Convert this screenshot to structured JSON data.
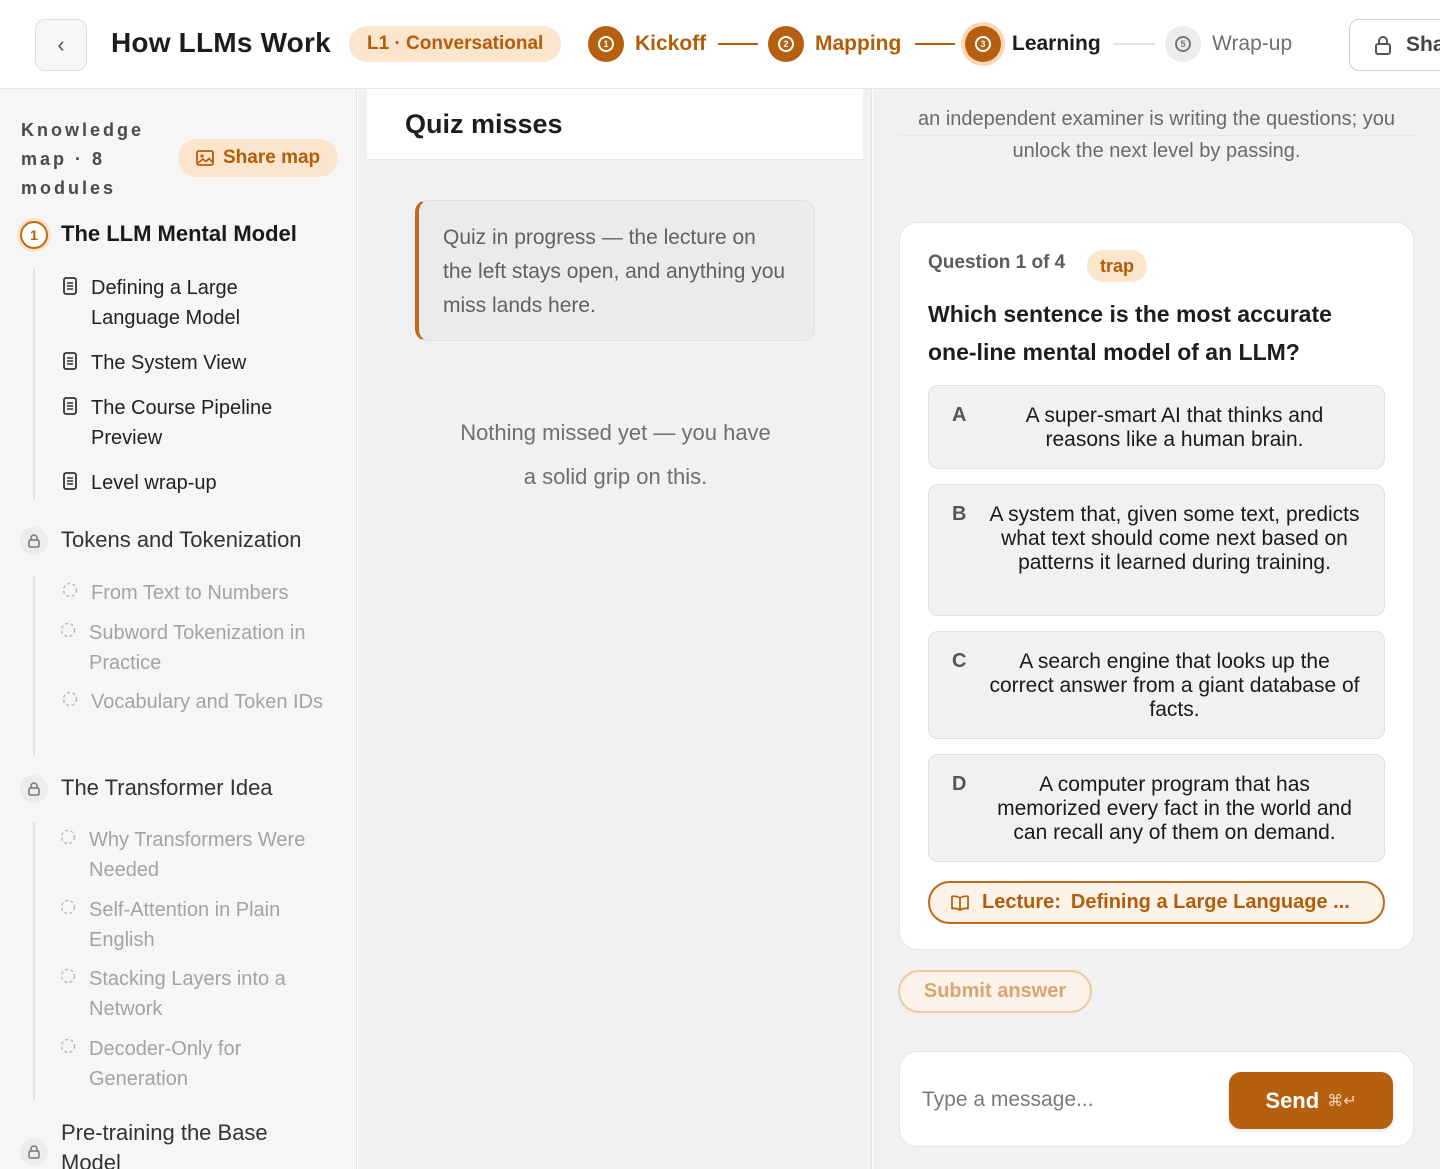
{
  "header": {
    "back_icon": "chevron-left-icon",
    "back_glyph": "‹",
    "title": "How LLMs Work",
    "level_badge": "L1 · Conversational",
    "steps": [
      {
        "num": "1",
        "label": "Kickoff",
        "state": "done"
      },
      {
        "num": "2",
        "label": "Mapping",
        "state": "done"
      },
      {
        "num": "3",
        "label": "Learning",
        "state": "current"
      },
      {
        "num": "5",
        "label": "Wrap-up",
        "state": "pending"
      }
    ],
    "share_label": "Sha"
  },
  "sidebar": {
    "heading": "Knowledge map · 8 modules",
    "share_map_label": "Share map",
    "modules": [
      {
        "num": "1",
        "title": "The LLM Mental Model",
        "state": "active",
        "lessons": [
          "Defining a Large Language Model",
          "The System View",
          "The Course Pipeline Preview",
          "Level wrap-up"
        ]
      },
      {
        "title": "Tokens and Tokenization",
        "state": "locked",
        "lessons": [
          "From Text to Numbers",
          "Subword Tokenization in Practice",
          "Vocabulary and Token IDs"
        ]
      },
      {
        "title": "The Transformer Idea",
        "state": "locked",
        "lessons": [
          "Why Transformers Were Needed",
          "Self-Attention in Plain English",
          "Stacking Layers into a Network",
          "Decoder-Only for Generation"
        ]
      },
      {
        "title": "Pre-training the Base Model",
        "state": "locked",
        "lessons": []
      }
    ]
  },
  "middle": {
    "title": "Quiz misses",
    "notice": "Quiz in progress — the lecture on the left stays open, and anything you miss lands here.",
    "empty": "Nothing missed yet — you have a solid grip on this."
  },
  "right": {
    "intro": "an independent examiner is writing the questions; you unlock the next level by passing.",
    "question_counter": "Question 1 of 4",
    "tag": "trap",
    "question": "Which sentence is the most accurate one-line mental model of an LLM?",
    "options": [
      {
        "letter": "A",
        "text": "A super-smart AI that thinks and reasons like a human brain."
      },
      {
        "letter": "B",
        "text": "A system that, given some text, predicts what text should come next based on patterns it learned during training."
      },
      {
        "letter": "C",
        "text": "A search engine that looks up the correct answer from a giant database of facts."
      },
      {
        "letter": "D",
        "text": "A computer program that has memorized every fact in the world and can recall any of them on demand."
      }
    ],
    "lecture_prefix": "Lecture:",
    "lecture_title": "Defining a Large Language ...",
    "submit_label": "Submit answer",
    "message_placeholder": "Type a message...",
    "send_label": "Send",
    "send_shortcut": "⌘↵"
  },
  "colors": {
    "accent": "#b5600e",
    "accent_text": "#b25d0a",
    "accent_soft": "#fbe5cc",
    "panel_bg": "#f1f1f1"
  }
}
